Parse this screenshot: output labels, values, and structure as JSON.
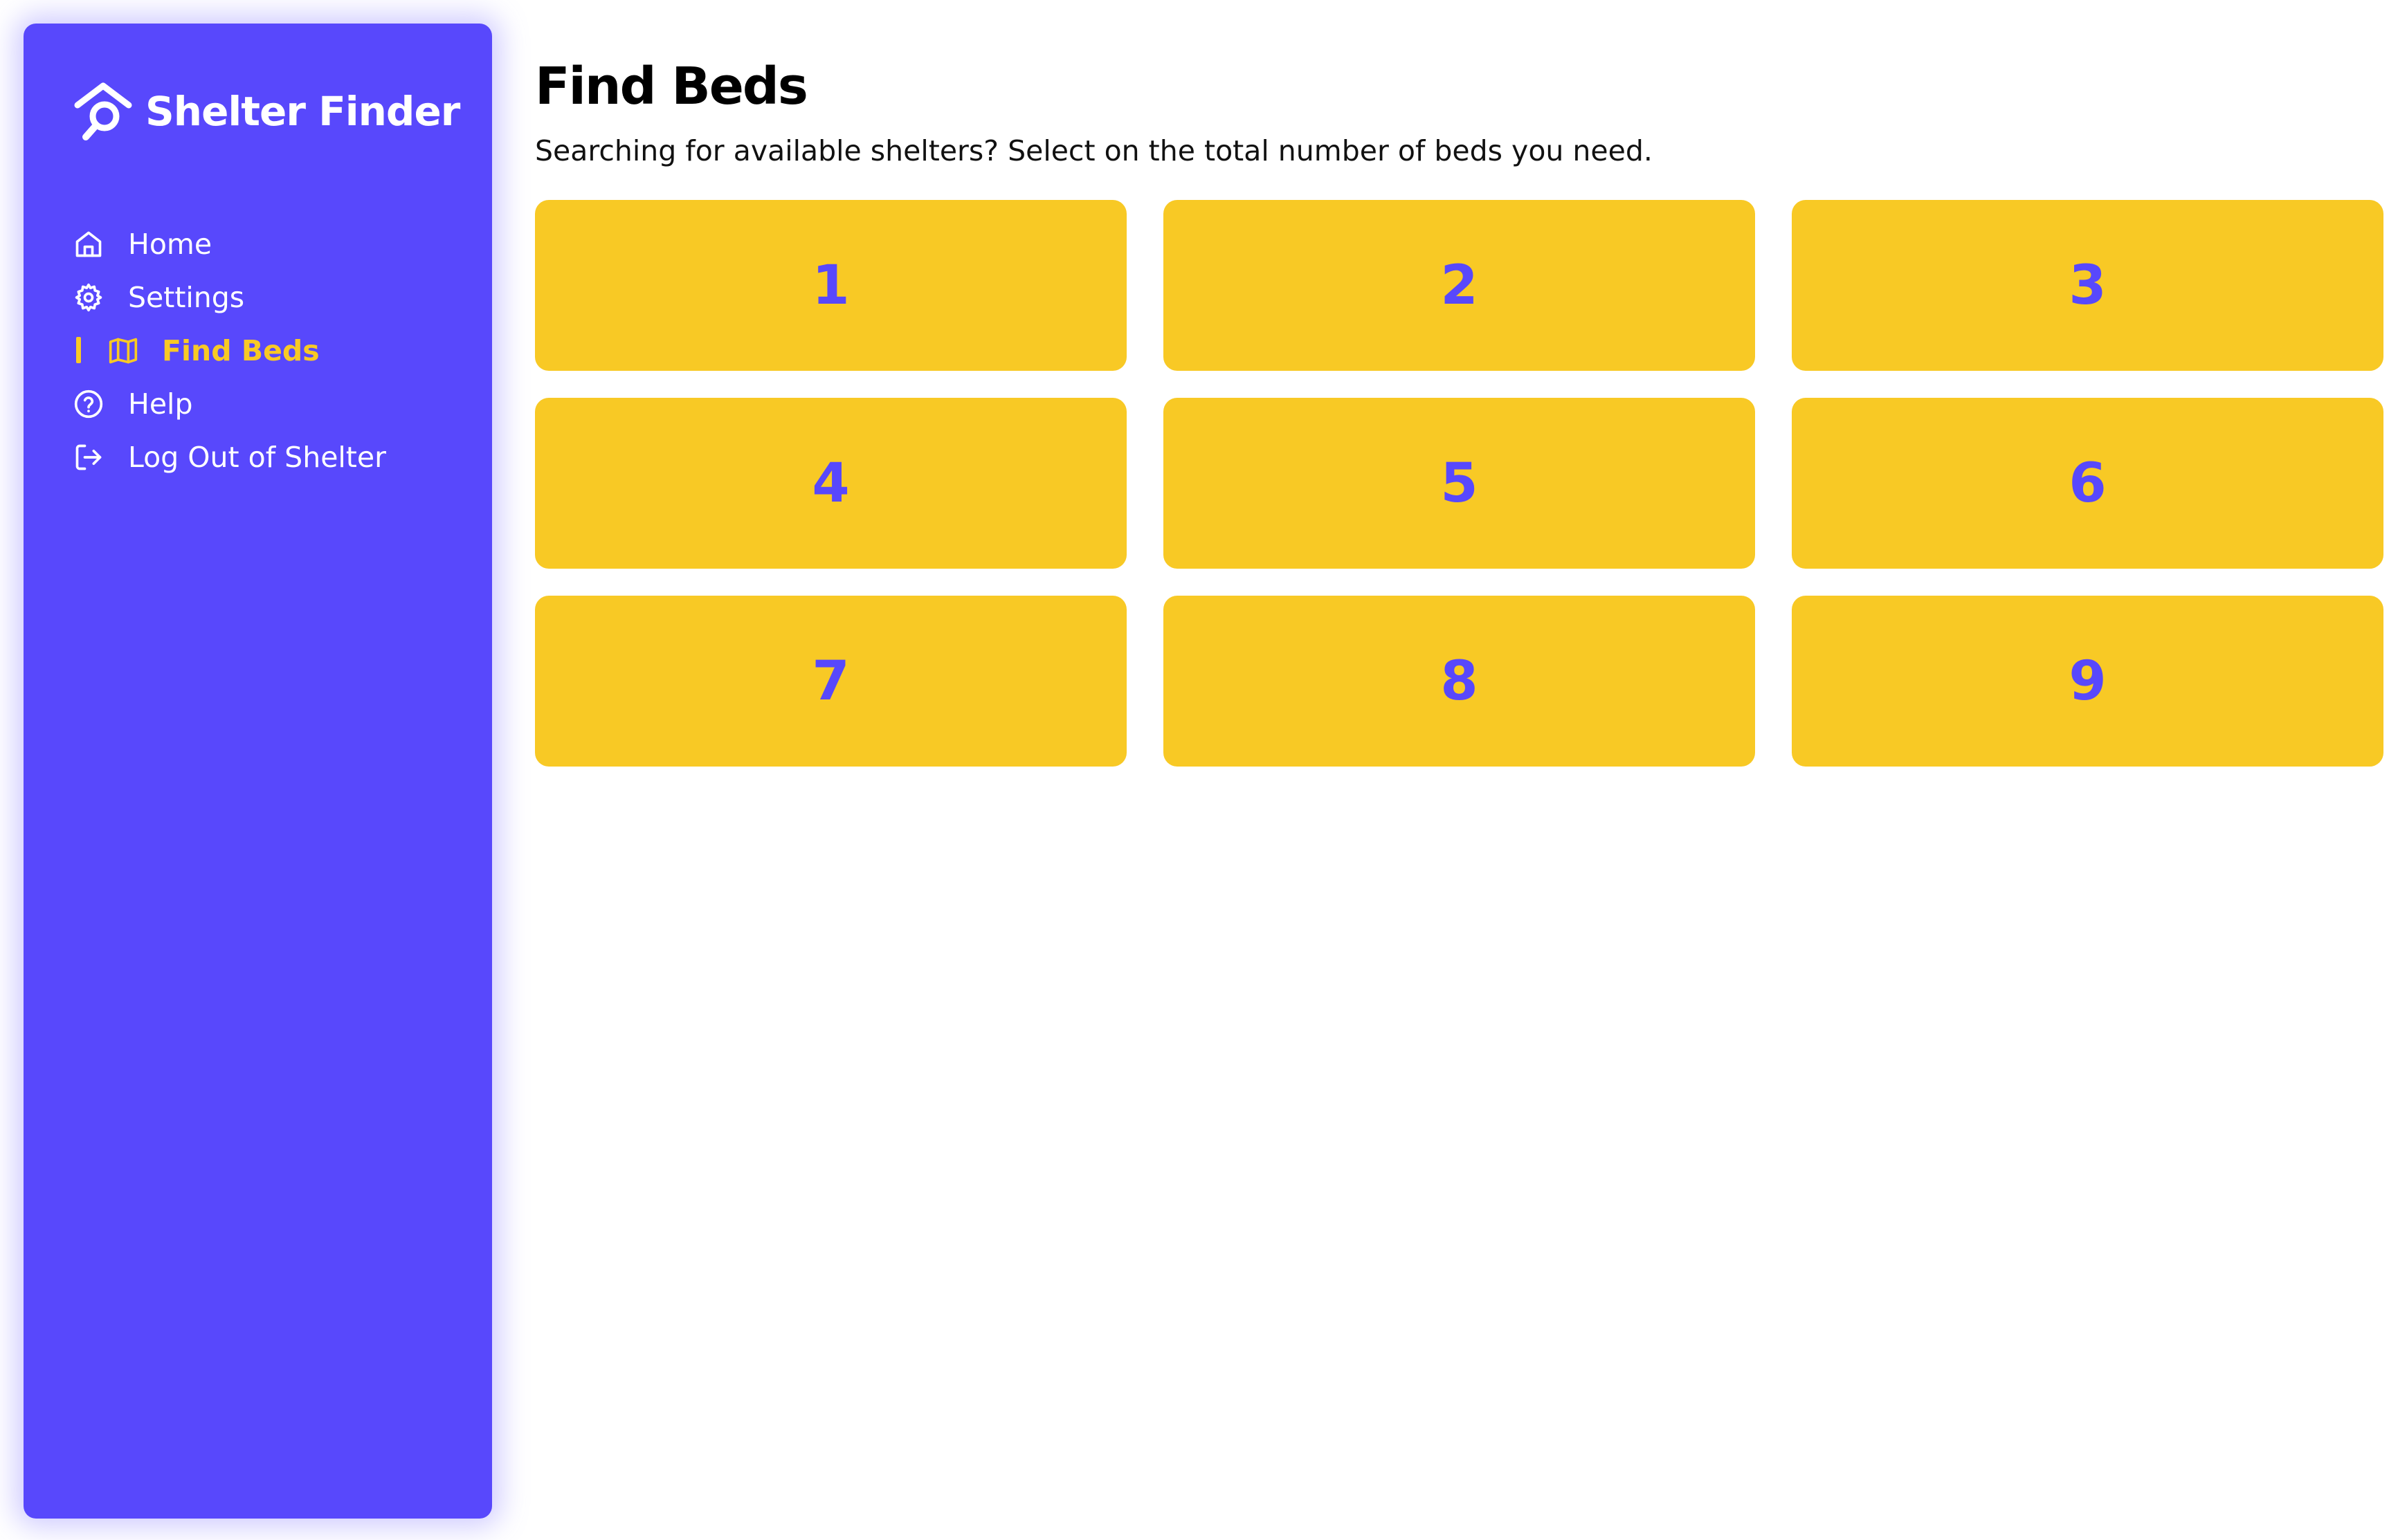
{
  "colors": {
    "sidebar": "#5848fc",
    "accent": "#f8c925",
    "button_text": "#5848fc"
  },
  "brand": {
    "name": "Shelter Finder",
    "icon": "house-search-icon"
  },
  "nav": [
    {
      "label": "Home",
      "icon": "home-icon",
      "active": false
    },
    {
      "label": "Settings",
      "icon": "gear-icon",
      "active": false
    },
    {
      "label": "Find Beds",
      "icon": "map-icon",
      "active": true
    },
    {
      "label": "Help",
      "icon": "help-circle-icon",
      "active": false
    },
    {
      "label": "Log Out of Shelter",
      "icon": "logout-icon",
      "active": false
    }
  ],
  "page": {
    "title": "Find Beds",
    "subtitle": "Searching for available shelters? Select on the total number of beds you need."
  },
  "bed_options": [
    "1",
    "2",
    "3",
    "4",
    "5",
    "6",
    "7",
    "8",
    "9"
  ]
}
